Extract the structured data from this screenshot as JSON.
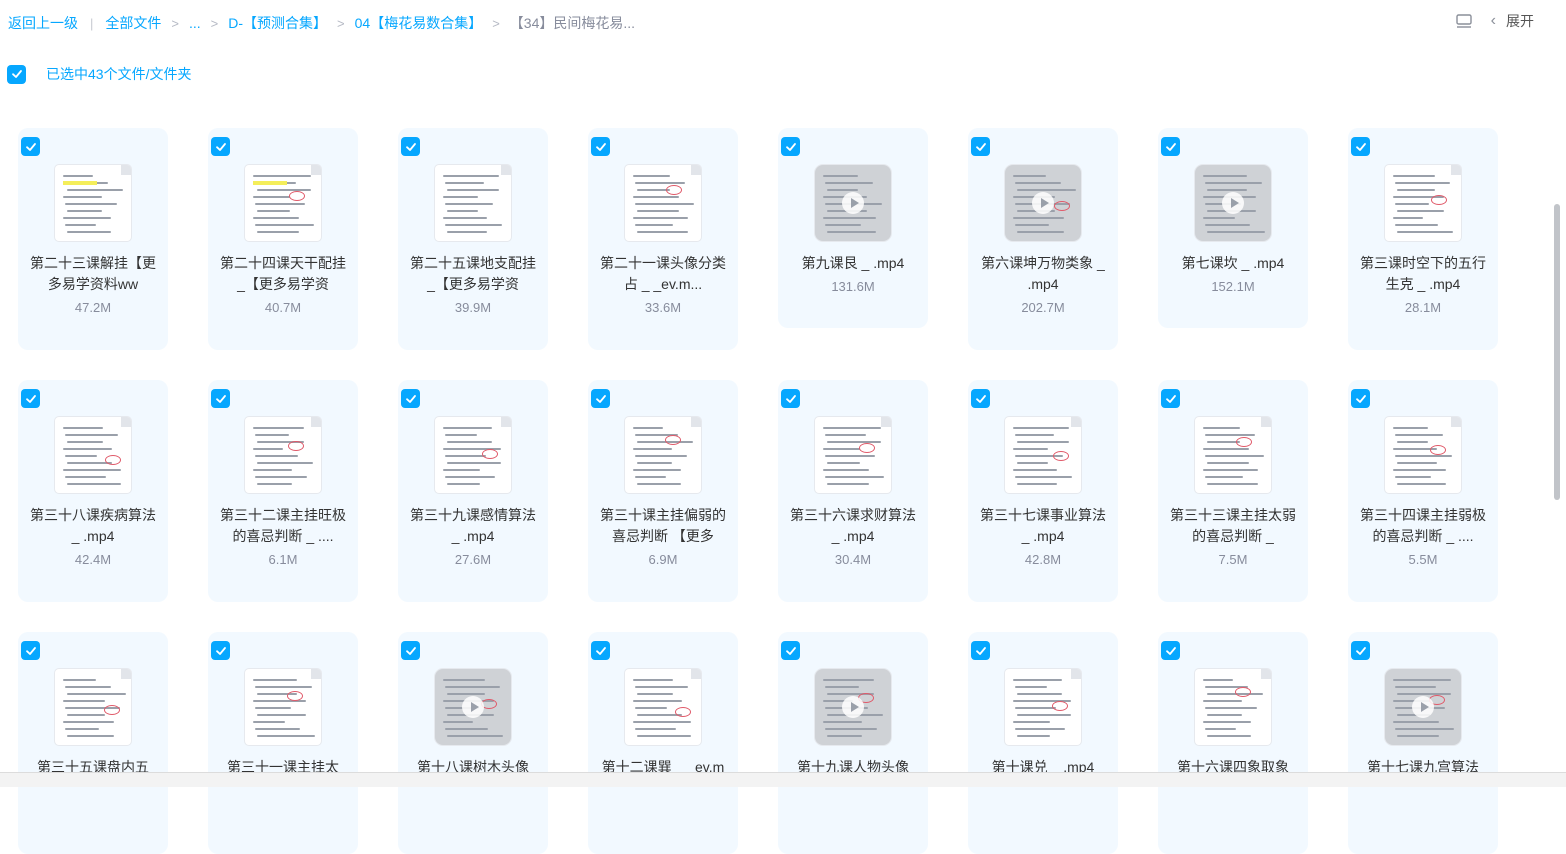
{
  "breadcrumb": {
    "back": "返回上一级",
    "all_files": "全部文件",
    "ellipsis": "...",
    "level1": "D-【预测合集】",
    "level2": "04【梅花易数合集】",
    "current": "【34】民间梅花易..."
  },
  "toolbar": {
    "expand_label": "展开"
  },
  "selection": {
    "text": "已选中43个文件/文件夹",
    "checked": true
  },
  "colors": {
    "accent": "#06a7ff",
    "card_bg": "#f2f9ff",
    "muted": "#878c9c"
  },
  "files": [
    {
      "name": "第二十三课解挂【更多易学资料ww",
      "size": "47.2M",
      "type": "doc"
    },
    {
      "name": "第二十四课天干配挂 _【更多易学资",
      "size": "40.7M",
      "type": "doc"
    },
    {
      "name": "第二十五课地支配挂 _【更多易学资",
      "size": "39.9M",
      "type": "doc"
    },
    {
      "name": "第二十一课头像分类占 _ _ev.m...",
      "size": "33.6M",
      "type": "doc"
    },
    {
      "name": "第九课艮 _ .mp4",
      "size": "131.6M",
      "type": "video"
    },
    {
      "name": "第六课坤万物类象 _ .mp4",
      "size": "202.7M",
      "type": "video"
    },
    {
      "name": "第七课坎 _ .mp4",
      "size": "152.1M",
      "type": "video"
    },
    {
      "name": "第三课时空下的五行生克 _ .mp4",
      "size": "28.1M",
      "type": "doc"
    },
    {
      "name": "第三十八课疾病算法 _ .mp4",
      "size": "42.4M",
      "type": "doc"
    },
    {
      "name": "第三十二课主挂旺极的喜忌判断 _ ....",
      "size": "6.1M",
      "type": "doc"
    },
    {
      "name": "第三十九课感情算法 _ .mp4",
      "size": "27.6M",
      "type": "doc"
    },
    {
      "name": "第三十课主挂偏弱的喜忌判断 【更多",
      "size": "6.9M",
      "type": "doc"
    },
    {
      "name": "第三十六课求财算法 _ .mp4",
      "size": "30.4M",
      "type": "doc"
    },
    {
      "name": "第三十七课事业算法 _ .mp4",
      "size": "42.8M",
      "type": "doc"
    },
    {
      "name": "第三十三课主挂太弱的喜忌判断 _",
      "size": "7.5M",
      "type": "doc"
    },
    {
      "name": "第三十四课主挂弱极的喜忌判断 _ ....",
      "size": "5.5M",
      "type": "doc"
    },
    {
      "name": "第三十五课盘内五",
      "size": "",
      "type": "doc"
    },
    {
      "name": "第三十一课主挂太",
      "size": "",
      "type": "doc"
    },
    {
      "name": "第十八课树木头像",
      "size": "",
      "type": "video"
    },
    {
      "name": "第十二课巽 _ _ev.m",
      "size": "",
      "type": "doc"
    },
    {
      "name": "第十九课人物头像",
      "size": "",
      "type": "video"
    },
    {
      "name": "第十课兑 _ .mp4",
      "size": "",
      "type": "doc"
    },
    {
      "name": "第十六课四象取象",
      "size": "",
      "type": "doc"
    },
    {
      "name": "第十七课九宫算法",
      "size": "",
      "type": "video"
    }
  ]
}
